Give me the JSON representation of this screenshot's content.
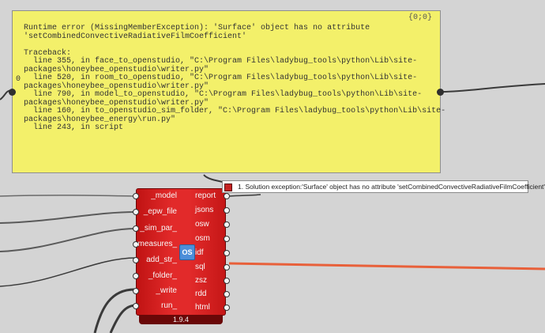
{
  "panel": {
    "coords": "{0;0}",
    "output_index": "0",
    "text": "Runtime error (MissingMemberException): 'Surface' object has no attribute\n'setCombinedConvectiveRadiativeFilmCoefficient'\n\nTraceback:\n  line 355, in face_to_openstudio, \"C:\\Program Files\\ladybug_tools\\python\\Lib\\site-\npackages\\honeybee_openstudio\\writer.py\"\n  line 520, in room_to_openstudio, \"C:\\Program Files\\ladybug_tools\\python\\Lib\\site-\npackages\\honeybee_openstudio\\writer.py\"\n  line 790, in model_to_openstudio, \"C:\\Program Files\\ladybug_tools\\python\\Lib\\site-\npackages\\honeybee_openstudio\\writer.py\"\n  line 160, in to_openstudio_sim_folder, \"C:\\Program Files\\ladybug_tools\\python\\Lib\\site-\npackages\\honeybee_energy\\run.py\"\n  line 243, in script"
  },
  "component": {
    "inputs": [
      "_model",
      "_epw_file",
      "_sim_par_",
      "measures_",
      "add_str_",
      "_folder_",
      "_write",
      "run_"
    ],
    "outputs": [
      "report",
      "jsons",
      "osw",
      "osm",
      "idf",
      "sql",
      "zsz",
      "rdd",
      "html"
    ],
    "version": "1.9.4",
    "icon": "honeybee-energy-icon",
    "icon_glyph": "OS",
    "color": "#e22a2a"
  },
  "warning": {
    "text": "1. Solution exception:'Surface' object has no attribute 'setCombinedConvectiveRadiativeFilmCoefficient'"
  },
  "colors": {
    "panel_bg": "#f3f06a",
    "canvas_bg": "#d4d4d4",
    "wire": "#3a3a3a",
    "wire_selected": "#e8603a"
  }
}
